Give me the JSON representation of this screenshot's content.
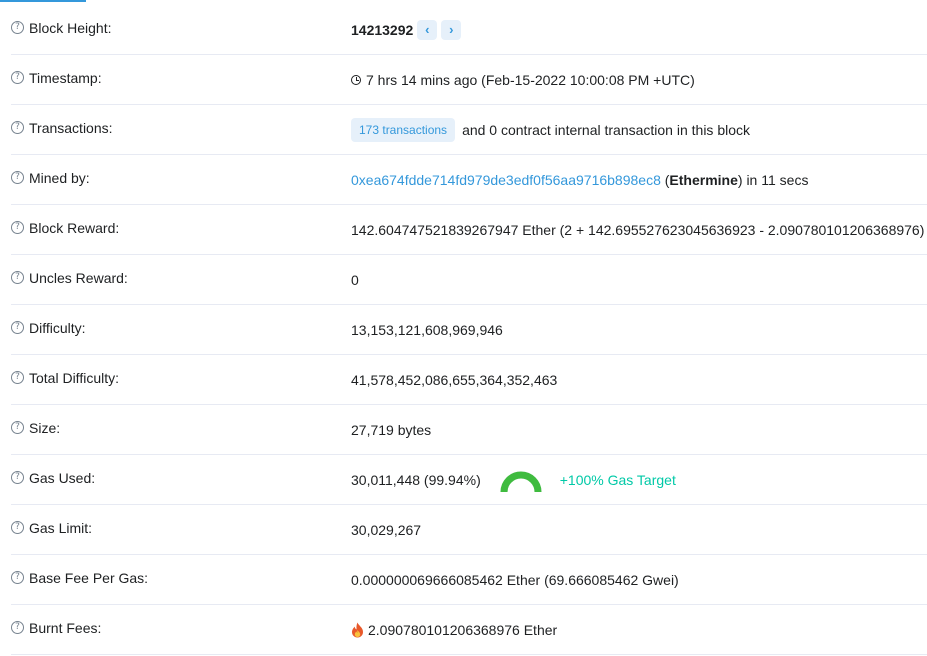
{
  "rows": {
    "block_height": {
      "label": "Block Height:",
      "value": "14213292"
    },
    "timestamp": {
      "label": "Timestamp:",
      "value": "7 hrs 14 mins ago (Feb-15-2022 10:00:08 PM +UTC)"
    },
    "transactions": {
      "label": "Transactions:",
      "badge": "173 transactions",
      "text": "and 0 contract internal transaction in this block"
    },
    "mined_by": {
      "label": "Mined by:",
      "address": "0xea674fdde714fd979de3edf0f56aa9716b898ec8",
      "open_paren": "(",
      "pool": "Ethermine",
      "suffix": ") in 11 secs"
    },
    "block_reward": {
      "label": "Block Reward:",
      "value": "142.604747521839267947 Ether (2 + 142.695527623045636923 - 2.090780101206368976)"
    },
    "uncles_reward": {
      "label": "Uncles Reward:",
      "value": "0"
    },
    "difficulty": {
      "label": "Difficulty:",
      "value": "13,153,121,608,969,946"
    },
    "total_difficulty": {
      "label": "Total Difficulty:",
      "value": "41,578,452,086,655,364,352,463"
    },
    "size": {
      "label": "Size:",
      "value": "27,719 bytes"
    },
    "gas_used": {
      "label": "Gas Used:",
      "value": "30,011,448 (99.94%)",
      "target": "+100% Gas Target",
      "gauge_fraction": 0.9994
    },
    "gas_limit": {
      "label": "Gas Limit:",
      "value": "30,029,267"
    },
    "base_fee": {
      "label": "Base Fee Per Gas:",
      "value": "0.000000069666085462 Ether (69.666085462 Gwei)"
    },
    "burnt_fees": {
      "label": "Burnt Fees:",
      "value": "2.090780101206368976 Ether"
    }
  },
  "icons": {
    "help": "question-circle-icon",
    "prev": "chevron-left-icon",
    "next": "chevron-right-icon",
    "clock": "clock-icon",
    "flame": "flame-icon"
  },
  "colors": {
    "accent": "#3498db",
    "green": "#00c9a7",
    "gauge": "#3fbb3f",
    "border": "#e7eaf3"
  }
}
